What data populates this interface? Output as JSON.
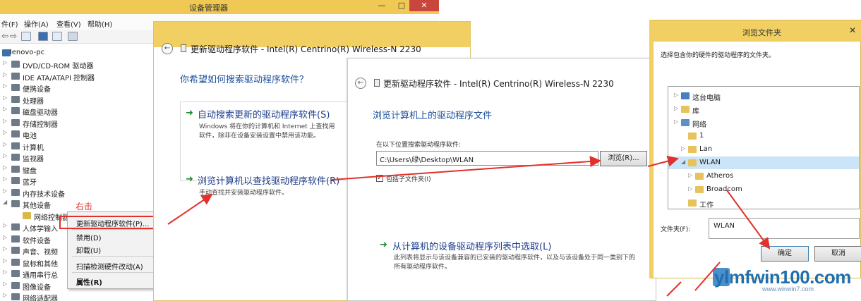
{
  "device_manager": {
    "title": "设备管理器",
    "menu": [
      "件(F)",
      "操作(A)",
      "查看(V)",
      "帮助(H)"
    ],
    "tree_root": "lenovo-pc",
    "tree_items": [
      "DVD/CD-ROM 驱动器",
      "IDE ATA/ATAPI 控制器",
      "便携设备",
      "处理器",
      "磁盘驱动器",
      "存储控制器",
      "电池",
      "计算机",
      "监视器",
      "键盘",
      "蓝牙",
      "内存技术设备",
      "其他设备",
      "网络控制器",
      "人体学输入",
      "软件设备",
      "声音、视频",
      "鼠标和其他",
      "通用串行总",
      "图像设备",
      "网络适配器"
    ]
  },
  "context_menu": {
    "annotation": "右击",
    "items": [
      "更新驱动程序软件(P)...",
      "禁用(D)",
      "卸载(U)",
      "扫描检测硬件改动(A)",
      "属性(R)"
    ]
  },
  "wizard1": {
    "title": "更新驱动程序软件 - Intel(R) Centrino(R) Wireless-N 2230",
    "question": "你希望如何搜索驱动程序软件？",
    "option_auto_label": "自动搜索更新的驱动程序软件(S)",
    "option_auto_desc_1": "Windows 将在你的计算机和 Internet 上查找用",
    "option_auto_desc_2": "软件，除非在设备安装设置中禁用该功能。",
    "option_browse_label": "浏览计算机以查找驱动程序软件(R)",
    "option_browse_desc": "手动查找并安装驱动程序软件。"
  },
  "wizard2": {
    "title": "更新驱动程序软件 - Intel(R) Centrino(R) Wireless-N 2230",
    "heading": "浏览计算机上的驱动程序文件",
    "search_label": "在以下位置搜索驱动程序软件:",
    "path_value": "C:\\Users\\绿\\Desktop\\WLAN",
    "browse_button": "浏览(R)...",
    "include_subfolders": "包括子文件夹(I)",
    "pick_label": "从计算机的设备驱动程序列表中选取(L)",
    "pick_desc_1": "此列表将显示与该设备兼容的已安装的驱动程序软件，以及与该设备处于同一类别下的",
    "pick_desc_2": "所有驱动程序软件。"
  },
  "browse_dialog": {
    "title": "浏览文件夹",
    "instruction": "选择包含你的硬件的驱动程序的文件夹。",
    "folders": [
      "这台电脑",
      "库",
      "网络",
      "1",
      "Lan",
      "WLAN",
      "Atheros",
      "Broadcom",
      "工作"
    ],
    "folder_label": "文件夹(F):",
    "folder_value": "WLAN",
    "ok_button": "确定",
    "cancel_button": "取消"
  },
  "watermark": {
    "text": "ylmfwin100.com",
    "sub": "www.winwin7.com"
  },
  "colors": {
    "title_yellow": "#f1cf62",
    "close_red": "#c9463d",
    "link_blue": "#1b4f9a",
    "annotation_red": "#e1312a",
    "arrow_green": "#1f8a2f"
  }
}
